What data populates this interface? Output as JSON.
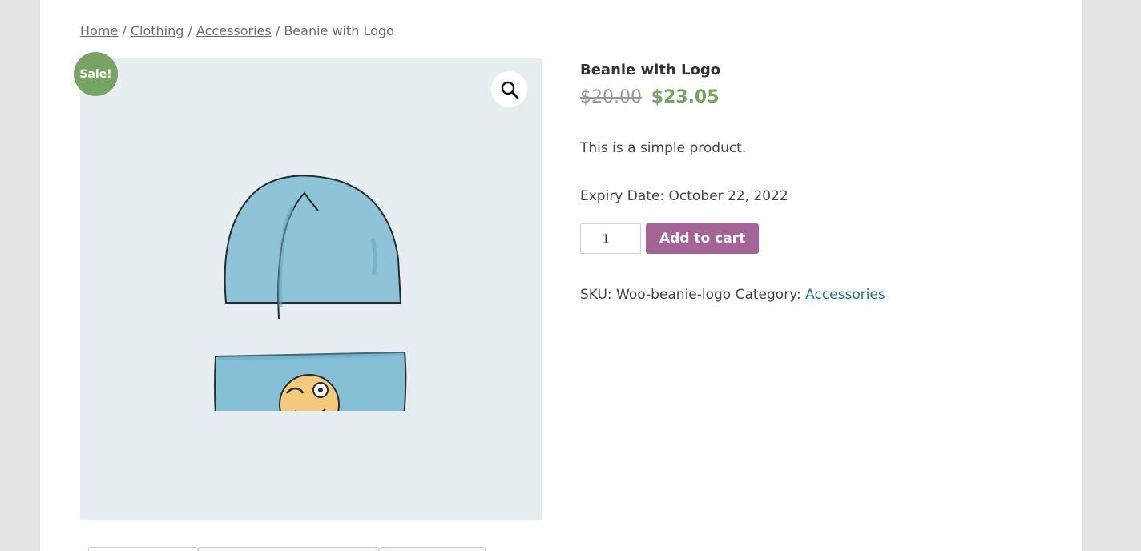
{
  "breadcrumb": {
    "home": "Home",
    "sep1": "/",
    "clothing": "Clothing",
    "sep2": "/",
    "accessories": "Accessories",
    "sep3": "/",
    "current": "Beanie with Logo"
  },
  "gallery": {
    "sale_badge": "Sale!",
    "zoom_icon": "magnifier-icon",
    "background": "#e6eef2"
  },
  "product": {
    "title": "Beanie with Logo",
    "price_old": "$20.00",
    "price_new": "$23.05",
    "description": "This is a simple product.",
    "expiry": "Expiry Date: October 22, 2022",
    "quantity": "1",
    "add_to_cart": "Add to cart",
    "meta_sku": "SKU: Woo-beanie-logo Category: ",
    "meta_category": "Accessories"
  },
  "colors": {
    "sale": "#77a464",
    "button": "#a46497",
    "link": "#2c6e8f",
    "strike": "#999999"
  }
}
